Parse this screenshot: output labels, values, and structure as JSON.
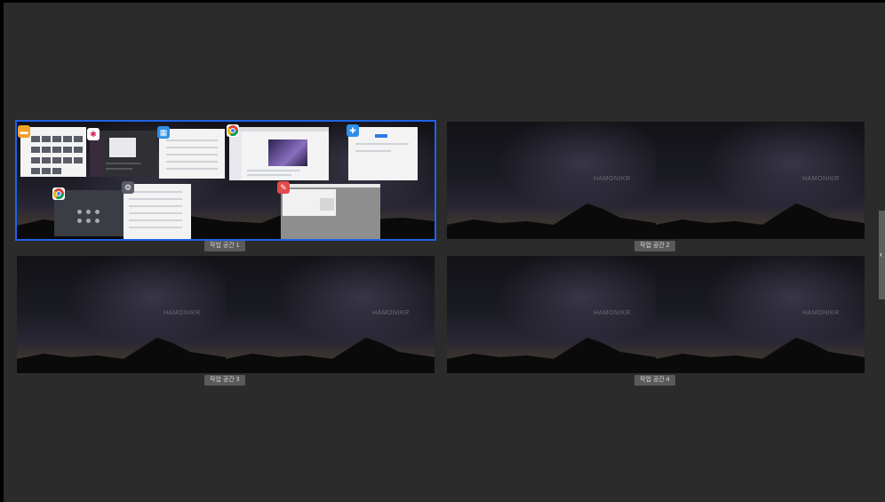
{
  "workspaces": [
    {
      "label": "작업 공간 1",
      "selected": true
    },
    {
      "label": "작업 공간 2",
      "selected": false
    },
    {
      "label": "작업 공간 3",
      "selected": false
    },
    {
      "label": "작업 공간 4",
      "selected": false
    }
  ],
  "wallpaper_logo": "HAMONIKR",
  "apps": {
    "files": {
      "icon": "folder-icon",
      "color": "#f0a22a"
    },
    "slack": {
      "icon": "slack-icon",
      "color": "#ffffff"
    },
    "web_app": {
      "icon": "app-icon",
      "color": "#2e8fe8"
    },
    "chrome": {
      "icon": "chrome-icon",
      "color": "#ffffff"
    },
    "extension": {
      "icon": "puzzle-icon",
      "color": "#2e8fe8"
    },
    "chrome_secondary": {
      "icon": "chrome-icon",
      "color": "#ffffff"
    },
    "settings": {
      "icon": "settings-icon",
      "color": "#5a5c66"
    },
    "paint": {
      "icon": "brush-icon",
      "color": "#e24b4b"
    }
  },
  "accent_color": "#1e63e8"
}
